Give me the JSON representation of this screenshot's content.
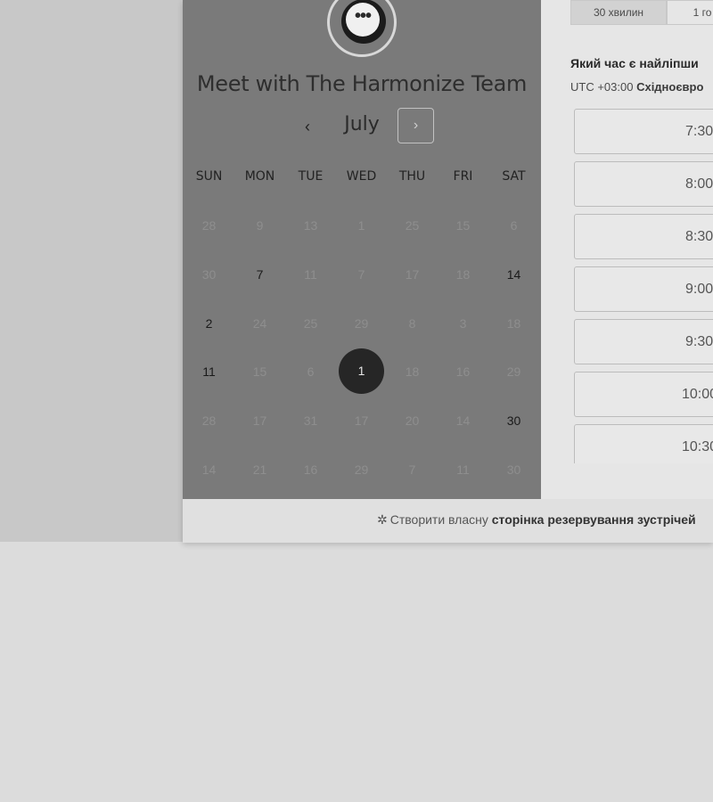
{
  "header": {
    "title": "Meet with The Harmonize Team"
  },
  "avatar": {
    "icon": "chat-bubble-icon",
    "glyph": "•••"
  },
  "calendar": {
    "month": "July",
    "prev_glyph": "‹",
    "next_glyph": "›",
    "weekdays": [
      "SUN",
      "MON",
      "TUE",
      "WED",
      "THU",
      "FRI",
      "SAT"
    ],
    "weeks": [
      [
        {
          "d": "28",
          "s": "dim"
        },
        {
          "d": "9",
          "s": "dim"
        },
        {
          "d": "13",
          "s": "dim"
        },
        {
          "d": "1",
          "s": "dim"
        },
        {
          "d": "25",
          "s": "dim"
        },
        {
          "d": "15",
          "s": "dim"
        },
        {
          "d": "6",
          "s": "dim"
        }
      ],
      [
        {
          "d": "30",
          "s": "dim"
        },
        {
          "d": "7",
          "s": "avail"
        },
        {
          "d": "11",
          "s": "dim"
        },
        {
          "d": "7",
          "s": "dim"
        },
        {
          "d": "17",
          "s": "dim"
        },
        {
          "d": "18",
          "s": "dim"
        },
        {
          "d": "14",
          "s": "avail"
        }
      ],
      [
        {
          "d": "2",
          "s": "avail"
        },
        {
          "d": "24",
          "s": "dim"
        },
        {
          "d": "25",
          "s": "dim"
        },
        {
          "d": "29",
          "s": "dim"
        },
        {
          "d": "8",
          "s": "dim"
        },
        {
          "d": "3",
          "s": "dim"
        },
        {
          "d": "18",
          "s": "dim"
        }
      ],
      [
        {
          "d": "11",
          "s": "avail"
        },
        {
          "d": "15",
          "s": "dim"
        },
        {
          "d": "6",
          "s": "dim"
        },
        {
          "d": "1",
          "s": "sel"
        },
        {
          "d": "18",
          "s": "dim"
        },
        {
          "d": "16",
          "s": "dim"
        },
        {
          "d": "29",
          "s": "dim"
        }
      ],
      [
        {
          "d": "28",
          "s": "dim"
        },
        {
          "d": "17",
          "s": "dim"
        },
        {
          "d": "31",
          "s": "dim"
        },
        {
          "d": "17",
          "s": "dim"
        },
        {
          "d": "20",
          "s": "dim"
        },
        {
          "d": "14",
          "s": "dim"
        },
        {
          "d": "30",
          "s": "avail"
        }
      ],
      [
        {
          "d": "14",
          "s": "dim"
        },
        {
          "d": "21",
          "s": "dim"
        },
        {
          "d": "16",
          "s": "dim"
        },
        {
          "d": "29",
          "s": "dim"
        },
        {
          "d": "7",
          "s": "dim"
        },
        {
          "d": "11",
          "s": "dim"
        },
        {
          "d": "30",
          "s": "dim"
        }
      ]
    ]
  },
  "duration": {
    "active": "30 хвилин",
    "other": "1 го"
  },
  "time_picker": {
    "question": "Який час є найліпши",
    "timezone_prefix": "UTC +03:00 ",
    "timezone_name": "Східноєвро",
    "slots": [
      "7:30",
      "8:00",
      "8:30",
      "9:00",
      "9:30",
      "10:00",
      "10:30"
    ]
  },
  "footer": {
    "prefix": "Створити власну ",
    "link": "сторінка резервування зустрічей"
  },
  "colors": {
    "left_panel": "#7a7a7a",
    "selected_day": "#262626",
    "page_bg": "#dcdcdc"
  }
}
